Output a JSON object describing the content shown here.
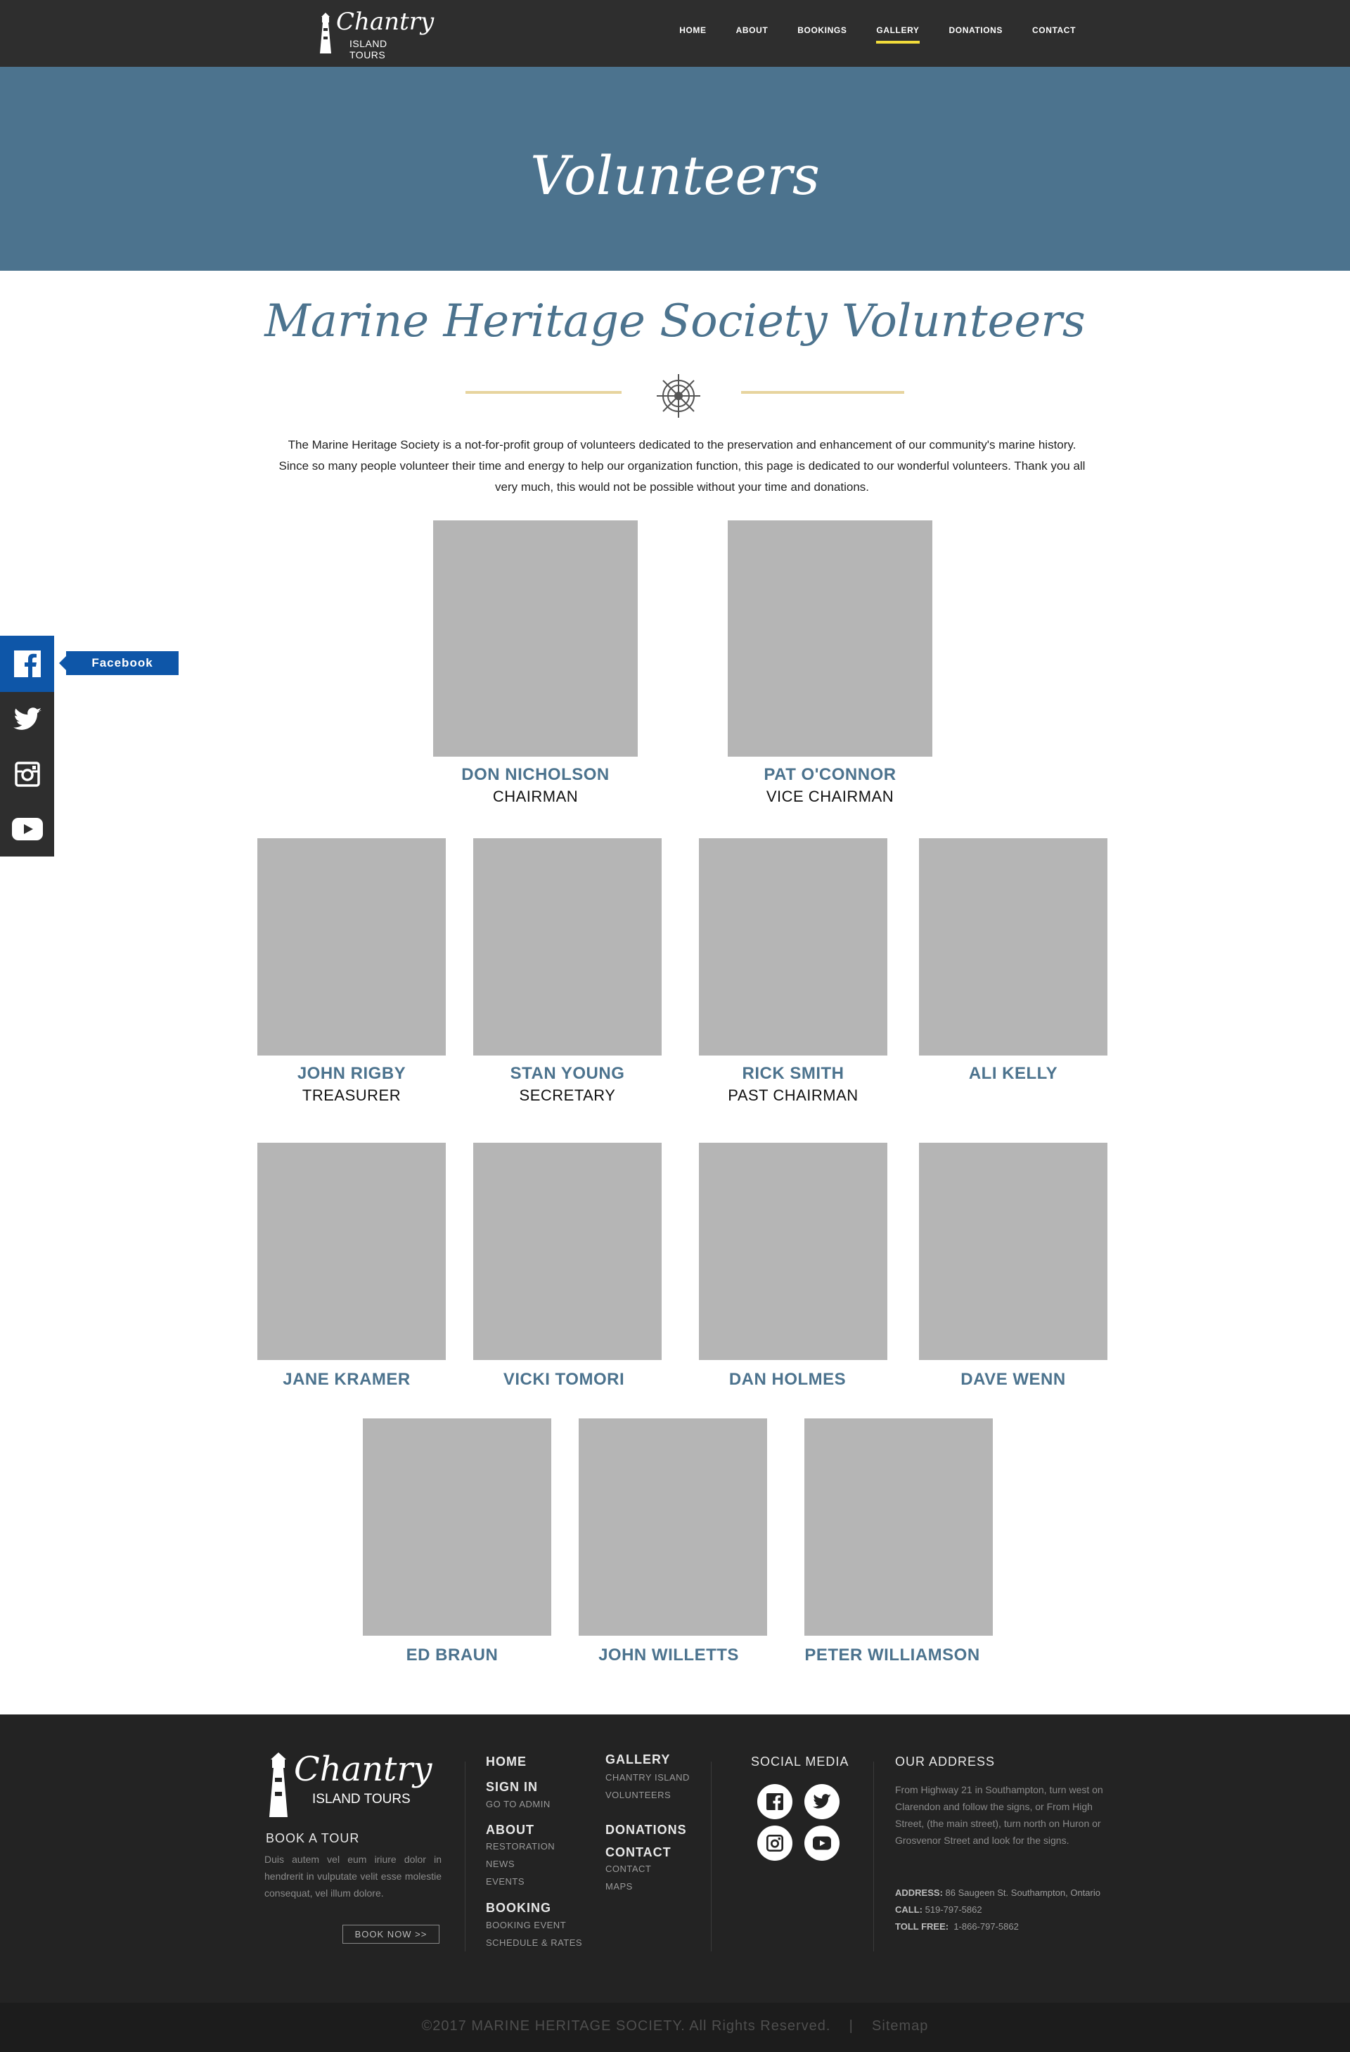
{
  "header": {
    "logo_script": "Chantry",
    "logo_sub": "ISLAND TOURS",
    "nav": [
      "HOME",
      "ABOUT",
      "BOOKINGS",
      "GALLERY",
      "DONATIONS",
      "CONTACT"
    ],
    "active_nav": "GALLERY",
    "accent_color": "#f2dc3b"
  },
  "banner": {
    "title": "Volunteers",
    "bg_color": "#4c738e"
  },
  "section": {
    "title": "Marine Heritage Society Volunteers",
    "intro": "The Marine Heritage Society is a not-for-profit group of volunteers dedicated to the preservation and enhancement of our community's marine history. Since so many people volunteer their time and energy to help our organization function, this page is dedicated to our wonderful volunteers. Thank you all very much, this would not be possible without your time and donations.",
    "divider_icon": "ship-wheel-icon"
  },
  "volunteers": [
    {
      "name": "DON NICHOLSON",
      "role": "CHAIRMAN"
    },
    {
      "name": "PAT O'CONNOR",
      "role": "VICE CHAIRMAN"
    },
    {
      "name": "JOHN RIGBY",
      "role": "TREASURER"
    },
    {
      "name": "STAN YOUNG",
      "role": "SECRETARY"
    },
    {
      "name": "RICK SMITH",
      "role": "PAST CHAIRMAN"
    },
    {
      "name": "ALI KELLY",
      "role": ""
    },
    {
      "name": "JANE KRAMER",
      "role": ""
    },
    {
      "name": "VICKI TOMORI",
      "role": ""
    },
    {
      "name": "DAN HOLMES",
      "role": ""
    },
    {
      "name": "DAVE WENN",
      "role": ""
    },
    {
      "name": "ED BRAUN",
      "role": ""
    },
    {
      "name": "JOHN WILLETTS",
      "role": ""
    },
    {
      "name": "PETER WILLIAMSON",
      "role": ""
    }
  ],
  "social_sidebar": {
    "items": [
      "facebook-icon",
      "twitter-icon",
      "instagram-icon",
      "youtube-icon"
    ],
    "facebook_tooltip": "Facebook",
    "facebook_color": "#0e56a8"
  },
  "footer": {
    "logo_script": "Chantry",
    "logo_sub": "ISLAND TOURS",
    "book_tour_heading": "BOOK A TOUR",
    "book_tour_text": "Duis autem vel eum iriure dolor in hendrerit in vulputate velit esse molestie consequat, vel illum dolore.",
    "book_now": "BOOK NOW >>",
    "col1": {
      "home": "HOME",
      "sign_in": "SIGN IN",
      "go_to_admin": "GO TO ADMIN",
      "about": "ABOUT",
      "about_links": [
        "RESTORATION",
        "NEWS",
        "EVENTS"
      ],
      "booking": "BOOKING",
      "booking_links": [
        "BOOKING EVENT",
        "SCHEDULE & RATES"
      ]
    },
    "col2": {
      "gallery": "GALLERY",
      "gallery_links": [
        "CHANTRY ISLAND",
        "VOLUNTEERS"
      ],
      "donations": "DONATIONS",
      "contact": "CONTACT",
      "contact_links": [
        "CONTACT",
        "MAPS"
      ]
    },
    "social_heading": "SOCIAL MEDIA",
    "social_icons": [
      "facebook-icon",
      "twitter-icon",
      "instagram-icon",
      "youtube-icon"
    ],
    "address_heading": "OUR ADDRESS",
    "address_text": "From Highway 21 in Southampton, turn west on Clarendon and follow the signs, or From High Street, (the main street), turn north on Huron or Grosvenor Street and look for the signs.",
    "address_label": "ADDRESS:",
    "address_value": "86 Saugeen St. Southampton, Ontario",
    "call_label": "CALL:",
    "call_value": "519-797-5862",
    "tollfree_label": "TOLL FREE:",
    "tollfree_value": "1-866-797-5862"
  },
  "copyright": "©2017 MARINE HERITAGE SOCIETY. All Rights Reserved.    |    Sitemap"
}
